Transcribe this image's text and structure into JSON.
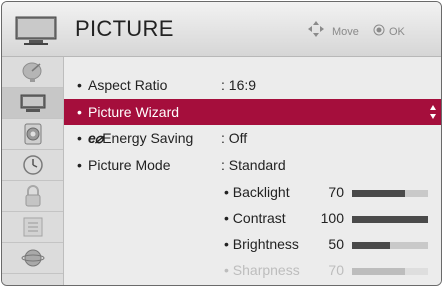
{
  "header": {
    "title": "PICTURE",
    "hint_move": "Move",
    "hint_ok": "OK"
  },
  "sidebar": {
    "items": [
      {
        "icon": "satellite-dish-icon",
        "active": false
      },
      {
        "icon": "tv-picture-icon",
        "active": true
      },
      {
        "icon": "speaker-audio-icon",
        "active": false
      },
      {
        "icon": "clock-time-icon",
        "active": false
      },
      {
        "icon": "padlock-icon",
        "active": false
      },
      {
        "icon": "option-settings-icon",
        "active": false
      },
      {
        "icon": "globe-network-icon",
        "active": false
      }
    ]
  },
  "menu": {
    "aspect_ratio": {
      "bullet": "•",
      "label": "Aspect Ratio",
      "value": ": 16:9"
    },
    "picture_wizard": {
      "bullet": "•",
      "label": "Picture Wizard"
    },
    "energy_saving": {
      "bullet": "•",
      "logo": "e⌀",
      "label": "Energy Saving",
      "value": ": Off"
    },
    "picture_mode": {
      "bullet": "•",
      "label": "Picture Mode",
      "value": ": Standard"
    },
    "settings": [
      {
        "label": "• Backlight",
        "value": "70",
        "level": 0.7,
        "dim": false
      },
      {
        "label": "• Contrast",
        "value": "100",
        "level": 1.0,
        "dim": false
      },
      {
        "label": "• Brightness",
        "value": "50",
        "level": 0.5,
        "dim": false
      },
      {
        "label": "• Sharpness",
        "value": "70",
        "level": 0.7,
        "dim": true
      }
    ]
  },
  "colors": {
    "selected_row": "#a50e3c",
    "bar_fill": "#4a4a4a",
    "bar_track": "#c9c9c9"
  }
}
